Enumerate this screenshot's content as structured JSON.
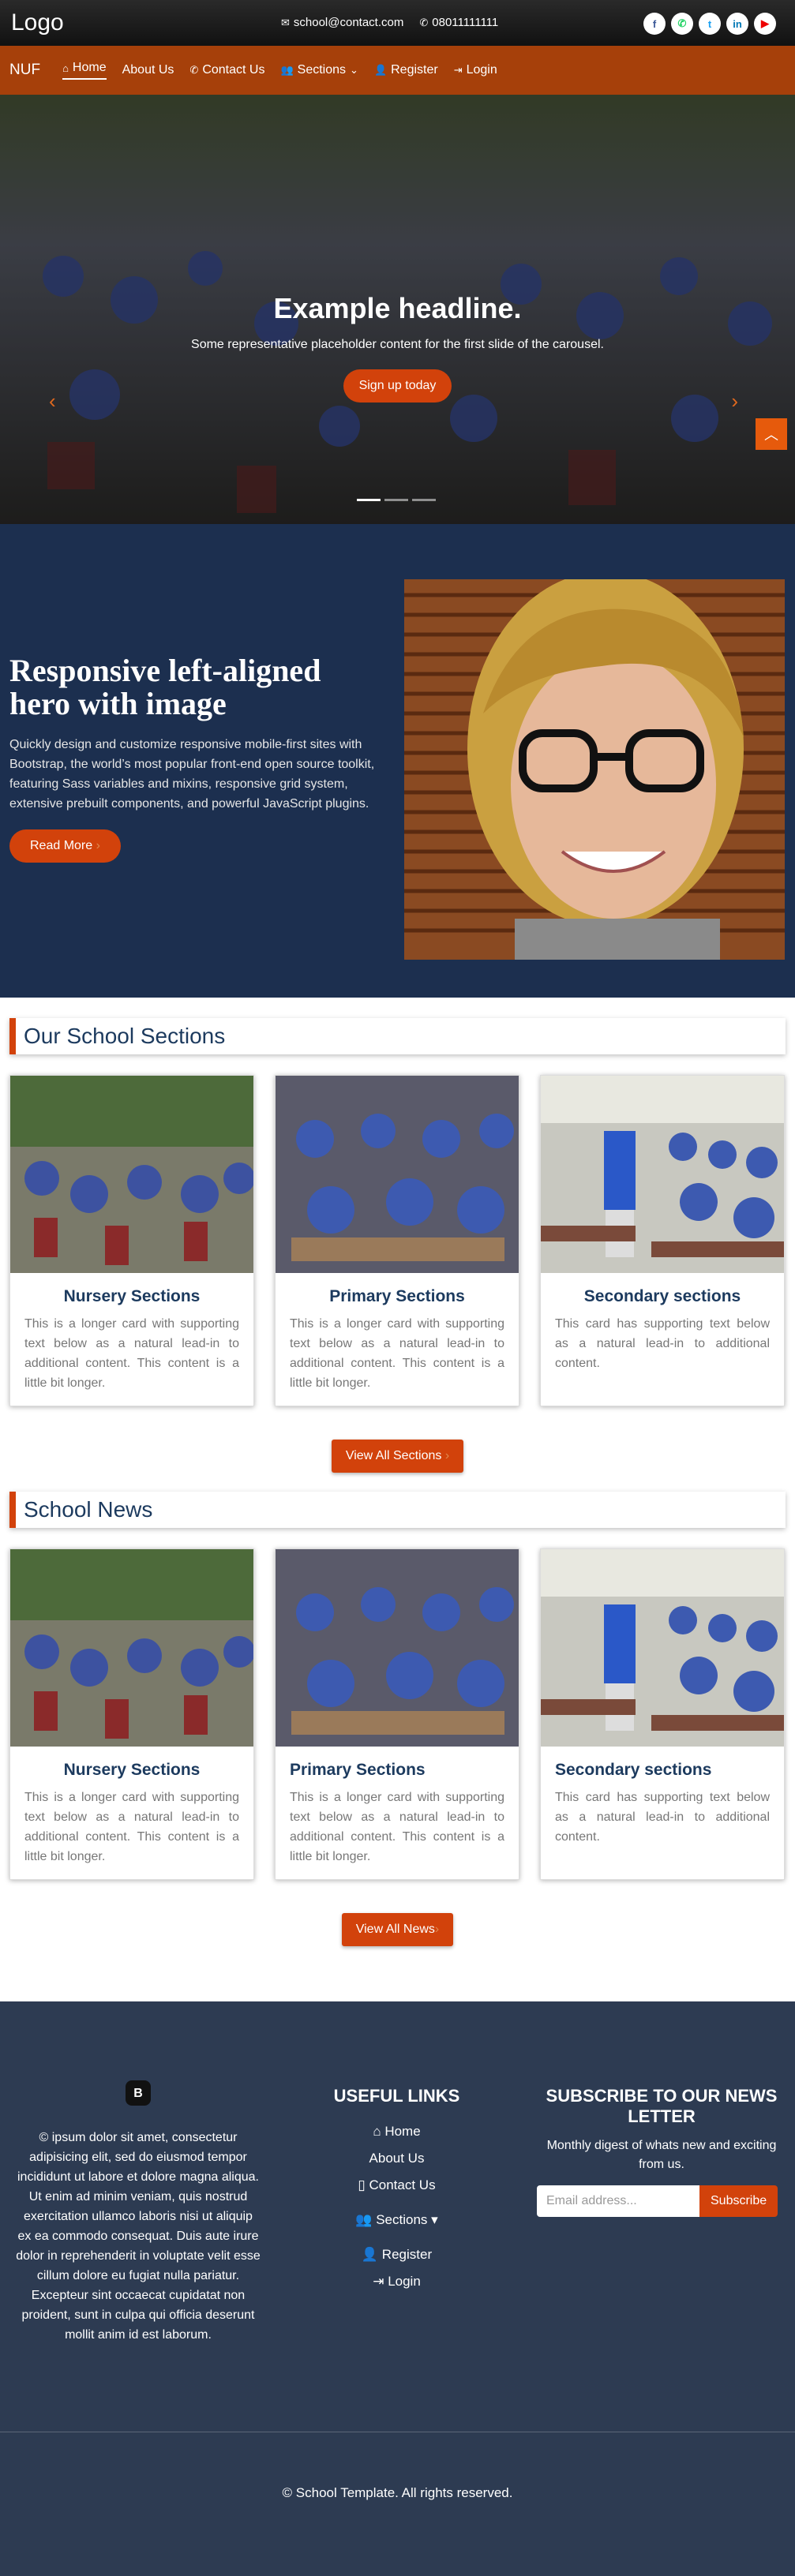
{
  "topbar": {
    "logo": "Logo",
    "email": "school@contact.com",
    "phone": "08011111111",
    "socials": [
      "f",
      "w",
      "t",
      "in",
      "yt"
    ]
  },
  "nav": {
    "brand": "NUF",
    "items": [
      {
        "icon": "home-icon",
        "label": "Home"
      },
      {
        "label": "About Us"
      },
      {
        "icon": "phone-icon",
        "label": "Contact Us"
      },
      {
        "icon": "users-icon",
        "label": "Sections"
      },
      {
        "icon": "user-icon",
        "label": "Register"
      },
      {
        "icon": "login-icon",
        "label": "Login"
      }
    ]
  },
  "carousel": {
    "headline": "Example headline.",
    "text": "Some representative placeholder content for the first slide of the carousel.",
    "button": "Sign up today"
  },
  "hero": {
    "title": "Responsive left-aligned hero with image",
    "text": "Quickly design and customize responsive mobile-first sites with Bootstrap, the world’s most popular front-end open source toolkit, featuring Sass variables and mixins, responsive grid system, extensive prebuilt components, and powerful JavaScript plugins.",
    "button": "Read More"
  },
  "sections": {
    "title": "Our School Sections",
    "cards": [
      {
        "title": "Nursery Sections",
        "text": "This is a longer card with supporting text below as a natural lead-in to additional content. This content is a little bit longer."
      },
      {
        "title": "Primary Sections",
        "text": "This is a longer card with supporting text below as a natural lead-in to additional content. This content is a little bit longer."
      },
      {
        "title": "Secondary sections",
        "text": "This card has supporting text below as a natural lead-in to additional content."
      }
    ],
    "button": "View All Sections"
  },
  "news": {
    "title": "School News",
    "cards": [
      {
        "title": "Nursery Sections",
        "text": "This is a longer card with supporting text below as a natural lead-in to additional content. This content is a little bit longer."
      },
      {
        "title": "Primary Sections",
        "text": "This is a longer card with supporting text below as a natural lead-in to additional content. This content is a little bit longer."
      },
      {
        "title": "Secondary sections",
        "text": "This card has supporting text below as a natural lead-in to additional content."
      }
    ],
    "button": "View All News"
  },
  "footer": {
    "logo": "B",
    "about": "© ipsum dolor sit amet, consectetur adipisicing elit, sed do eiusmod tempor incididunt ut labore et dolore magna aliqua. Ut enim ad minim veniam, quis nostrud exercitation ullamco laboris nisi ut aliquip ex ea commodo consequat. Duis aute irure dolor in reprehenderit in voluptate velit esse cillum dolore eu fugiat nulla pariatur. Excepteur sint occaecat cupidatat non proident, sunt in culpa qui officia deserunt mollit anim id est laborum.",
    "links_title": "USEFUL LINKS",
    "links": [
      "Home",
      "About Us",
      "Contact Us",
      "Sections",
      "Register",
      "Login"
    ],
    "subscribe_title": "SUBSCRIBE TO OUR NEWS LETTER",
    "subscribe_text": "Monthly digest of whats new and exciting from us.",
    "email_placeholder": "Email address...",
    "subscribe_button": "Subscribe",
    "copyright": "© School Template. All rights reserved."
  },
  "colors": {
    "primary": "#d2420b",
    "nav": "#a6400a",
    "hero": "#1c2f4f",
    "footer": "#2d3b52",
    "heading": "#1c3a5e"
  }
}
